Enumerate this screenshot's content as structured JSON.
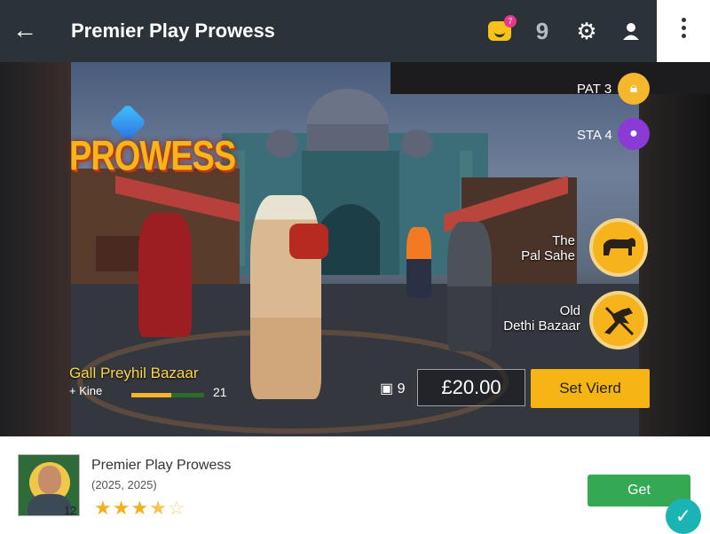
{
  "header": {
    "title": "Premier Play Prowess",
    "notification_count": "7",
    "pin_label": "9"
  },
  "scene": {
    "logo_text": "PROWESS",
    "side_tags": [
      "PAT 3",
      "STA 4"
    ],
    "locations": [
      {
        "label_line1": "The",
        "label_line2": "Pal Sahe"
      },
      {
        "label_line1": "Old",
        "label_line2": "Dethi Bazaar"
      }
    ],
    "mission_title": "Gall Preyhil Bazaar",
    "mission_sub": "+ Kine",
    "progress": 0.55,
    "progress_value": "21",
    "ticket_count": "9",
    "price": "£20.00",
    "cta_label": "Set Vierd"
  },
  "app": {
    "name": "Premier Play Prowess",
    "years": "(2025, 2025)",
    "age_rating": "12",
    "rating": 3.5,
    "get_label": "Get"
  },
  "colors": {
    "appbar": "#2b3238",
    "accent": "#f7b415",
    "get_button": "#34a853",
    "check_fab": "#1bb3b3"
  }
}
